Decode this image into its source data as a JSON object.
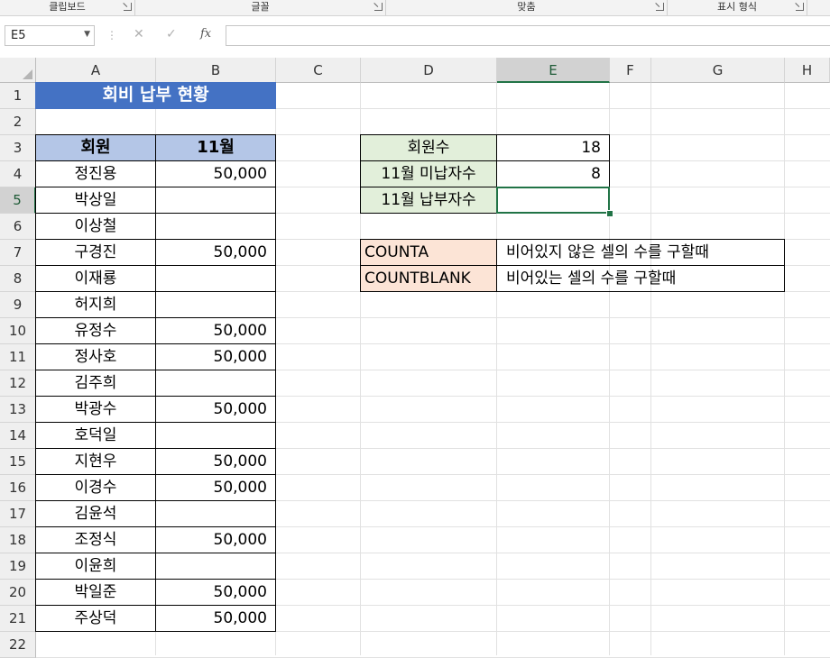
{
  "ribbon": {
    "groups": [
      {
        "label": "클립보드"
      },
      {
        "label": "글꼴"
      },
      {
        "label": "맞춤"
      },
      {
        "label": "표시 형식"
      }
    ]
  },
  "formula_bar": {
    "name_box": "E5",
    "formula": "",
    "fx_label": "fx",
    "cancel_icon": "✕",
    "enter_icon": "✓"
  },
  "columns": [
    "A",
    "B",
    "C",
    "D",
    "E",
    "F",
    "G",
    "H"
  ],
  "rows": [
    "1",
    "2",
    "3",
    "4",
    "5",
    "6",
    "7",
    "8",
    "9",
    "10",
    "11",
    "12",
    "13",
    "14",
    "15",
    "16",
    "17",
    "18",
    "19",
    "20",
    "21",
    "22"
  ],
  "selected": {
    "column": "E",
    "row": "5"
  },
  "table": {
    "title": "회비 납부 현황",
    "header_name": "회원",
    "header_month": "11월",
    "members": [
      {
        "name": "정진용",
        "paid": "50,000"
      },
      {
        "name": "박상일",
        "paid": ""
      },
      {
        "name": "이상철",
        "paid": ""
      },
      {
        "name": "구경진",
        "paid": "50,000"
      },
      {
        "name": "이재룡",
        "paid": ""
      },
      {
        "name": "허지희",
        "paid": ""
      },
      {
        "name": "유정수",
        "paid": "50,000"
      },
      {
        "name": "정사호",
        "paid": "50,000"
      },
      {
        "name": "김주희",
        "paid": ""
      },
      {
        "name": "박광수",
        "paid": "50,000"
      },
      {
        "name": "호덕일",
        "paid": ""
      },
      {
        "name": "지현우",
        "paid": "50,000"
      },
      {
        "name": "이경수",
        "paid": "50,000"
      },
      {
        "name": "김윤석",
        "paid": ""
      },
      {
        "name": "조정식",
        "paid": "50,000"
      },
      {
        "name": "이윤희",
        "paid": ""
      },
      {
        "name": "박일준",
        "paid": "50,000"
      },
      {
        "name": "주상덕",
        "paid": "50,000"
      }
    ]
  },
  "summary": [
    {
      "label": "회원수",
      "value": "18"
    },
    {
      "label": "11월 미납자수",
      "value": "8"
    },
    {
      "label": "11월 납부자수",
      "value": ""
    }
  ],
  "notes": [
    {
      "func": "COUNTA",
      "desc": "비어있지 않은 셀의 수를 구할때"
    },
    {
      "func": "COUNTBLANK",
      "desc": "비어있는 셀의 수를 구할때"
    }
  ],
  "colors": {
    "title_bg": "#4472c4",
    "header_bg": "#b4c6e7",
    "summary_label_bg": "#e2efda",
    "note_func_bg": "#fce4d6",
    "selection": "#217346"
  }
}
